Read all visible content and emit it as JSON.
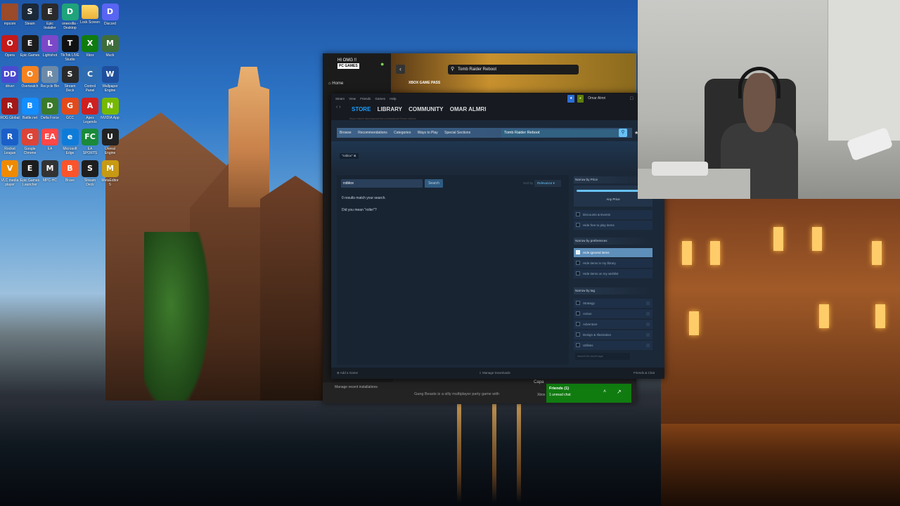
{
  "desktop_icons": [
    {
      "label": "mpcom",
      "kind": "photo",
      "color": "#9b4a2a",
      "glyph": ""
    },
    {
      "label": "Steam",
      "kind": "app",
      "color": "#1b2838",
      "glyph": "S"
    },
    {
      "label": "Epic Installer",
      "kind": "app",
      "color": "#2a2a2a",
      "glyph": "E"
    },
    {
      "label": "oneexilla - Desktop",
      "kind": "app",
      "color": "#1fa37a",
      "glyph": "D"
    },
    {
      "label": "Lock Screen",
      "kind": "folder",
      "color": "",
      "glyph": ""
    },
    {
      "label": "Discord",
      "kind": "app",
      "color": "#5865f2",
      "glyph": "D"
    },
    {
      "label": "Opera",
      "kind": "app",
      "color": "#c31a1a",
      "glyph": "O"
    },
    {
      "label": "Epic Games",
      "kind": "app",
      "color": "#1c1c1c",
      "glyph": "E"
    },
    {
      "label": "Lightshot",
      "kind": "app",
      "color": "#7b48c8",
      "glyph": "L"
    },
    {
      "label": "TikTok LIVE Studio",
      "kind": "app",
      "color": "#111111",
      "glyph": "T"
    },
    {
      "label": "Xbox",
      "kind": "app",
      "color": "#107c10",
      "glyph": "X"
    },
    {
      "label": "Muck",
      "kind": "app",
      "color": "#3e6d3a",
      "glyph": "M"
    },
    {
      "label": "driver",
      "kind": "app",
      "color": "#4a4ad0",
      "glyph": "DD"
    },
    {
      "label": "Overwatch",
      "kind": "app",
      "color": "#f58220",
      "glyph": "O"
    },
    {
      "label": "Recycle Bin",
      "kind": "app",
      "color": "#6c8aa8",
      "glyph": "R"
    },
    {
      "label": "Stream Deck",
      "kind": "app",
      "color": "#2a2a2a",
      "glyph": "S"
    },
    {
      "label": "Control Panel",
      "kind": "app",
      "color": "#2f6db0",
      "glyph": "C"
    },
    {
      "label": "Wallpaper Engine",
      "kind": "app",
      "color": "#1f4f9c",
      "glyph": "W"
    },
    {
      "label": "ROG Global",
      "kind": "app",
      "color": "#a31818",
      "glyph": "R"
    },
    {
      "label": "Battle.net",
      "kind": "app",
      "color": "#148eff",
      "glyph": "B"
    },
    {
      "label": "Delta Force",
      "kind": "app",
      "color": "#3a7a2a",
      "glyph": "D"
    },
    {
      "label": "GCC",
      "kind": "app",
      "color": "#e34a1a",
      "glyph": "G"
    },
    {
      "label": "Apex Legends",
      "kind": "app",
      "color": "#cf2020",
      "glyph": "A"
    },
    {
      "label": "NVIDIA App",
      "kind": "app",
      "color": "#76b900",
      "glyph": "N"
    },
    {
      "label": "Rocket League",
      "kind": "app",
      "color": "#1a5fc8",
      "glyph": "R"
    },
    {
      "label": "Google Chrome",
      "kind": "app",
      "color": "#db4437",
      "glyph": "G"
    },
    {
      "label": "EA",
      "kind": "app",
      "color": "#ff4747",
      "glyph": "EA"
    },
    {
      "label": "Microsoft Edge",
      "kind": "app",
      "color": "#0f7bd8",
      "glyph": "e"
    },
    {
      "label": "EA SPORTS FC 25",
      "kind": "app",
      "color": "#1a8a3a",
      "glyph": "FC"
    },
    {
      "label": "Unreal Engine",
      "kind": "app",
      "color": "#222222",
      "glyph": "U"
    },
    {
      "label": "VLC media player",
      "kind": "app",
      "color": "#f08a00",
      "glyph": "V"
    },
    {
      "label": "Epic Games Launcher",
      "kind": "app",
      "color": "#1c1c1c",
      "glyph": "E"
    },
    {
      "label": "MPC-HC",
      "kind": "app",
      "color": "#333333",
      "glyph": "M"
    },
    {
      "label": "Brave",
      "kind": "app",
      "color": "#fb542b",
      "glyph": "B"
    },
    {
      "label": "Stream Deck",
      "kind": "app",
      "color": "#1e1e1e",
      "glyph": "S"
    },
    {
      "label": "MetaEditor 5",
      "kind": "app",
      "color": "#c89a14",
      "glyph": "M"
    }
  ],
  "xbox": {
    "user_name": "HI OMG !!",
    "badge": "PC GAMES",
    "home": "Home",
    "search_value": "Tomb Raider Reboot",
    "game_pass": "XBOX GAME PASS",
    "recent": "Manage recent installations",
    "promo": "Gang Beasts is a silly multiplayer party game with",
    "capa": "Capa",
    "xbox_label": "Xbox",
    "friends_title": "Friends (1)",
    "friends_sub": "1 unread chat"
  },
  "steam": {
    "menu": [
      "Steam",
      "View",
      "Friends",
      "Games",
      "Help"
    ],
    "tabs": [
      "STORE",
      "LIBRARY",
      "COMMUNITY",
      "OMAR ALMRI"
    ],
    "url": "https://store.steampowered.com/search/?term=roblox",
    "user": "Omar Almri",
    "store_nav": [
      "Browse",
      "Recommendations",
      "Categories",
      "Ways to Play",
      "Special Sections"
    ],
    "store_search": "Tomb Raider Reboot",
    "crumb": "\"roblox\"",
    "search_term": "roblox",
    "search_btn": "Search",
    "sort_label": "Sort by",
    "sort_value": "Relevance",
    "no_results": "0 results match your search.",
    "did_you_mean": "Did you mean \"roller\"?",
    "narrow_price": "Narrow by Price",
    "any_price": "Any Price",
    "price_opts": [
      "Discounts & Events",
      "Hide free to play items"
    ],
    "narrow_pref": "Narrow by preferences",
    "pref_opts": [
      "Hide ignored items",
      "Hide items in my library",
      "Hide items on my wishlist"
    ],
    "narrow_tag": "Narrow by tag",
    "tags": [
      "Strategy",
      "Action",
      "Adventure",
      "Design & Illustration",
      "Utilities"
    ],
    "more_tags": "search for more tags",
    "foot_add": "Add a Game",
    "foot_dl": "Manage Downloads",
    "foot_friends": "Friends & Chat"
  },
  "colors": {
    "steam_accent": "#1a9fff",
    "xbox_green": "#107c10",
    "steam_bg": "#1b2838"
  }
}
